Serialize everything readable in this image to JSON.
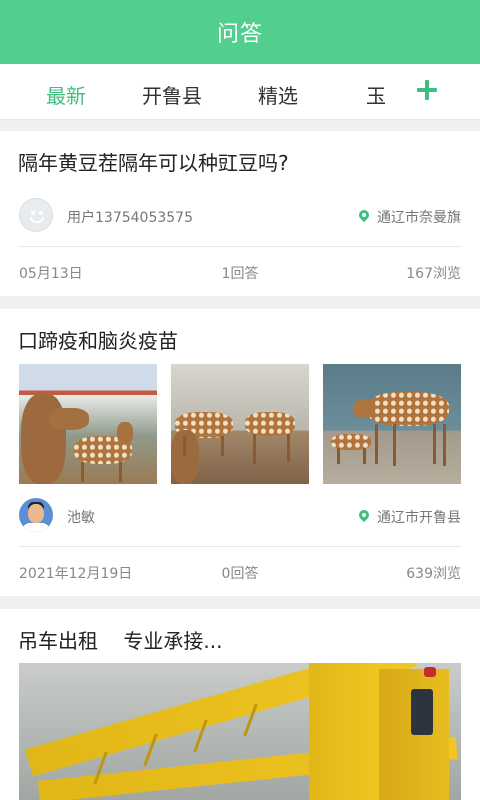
{
  "header": {
    "title": "问答"
  },
  "tabs": [
    "最新",
    "开鲁县",
    "精选",
    "玉"
  ],
  "questions": [
    {
      "title": "隔年黄豆茬隔年可以种豇豆吗?",
      "user": "用户13754053575",
      "location": "通辽市奈曼旗",
      "date": "05月13日",
      "answers": "1回答",
      "views": "167浏览"
    },
    {
      "title": "口蹄疫和脑炎疫苗",
      "user": "池敏",
      "location": "通辽市开鲁县",
      "date": "2021年12月19日",
      "answers": "0回答",
      "views": "639浏览"
    },
    {
      "title": "吊车出租    专业承接..."
    }
  ],
  "colors": {
    "accent": "#52cf8f",
    "tab_active": "#3fbf7f"
  },
  "icons": {
    "add": "plus-icon",
    "location": "location-pin-icon"
  }
}
